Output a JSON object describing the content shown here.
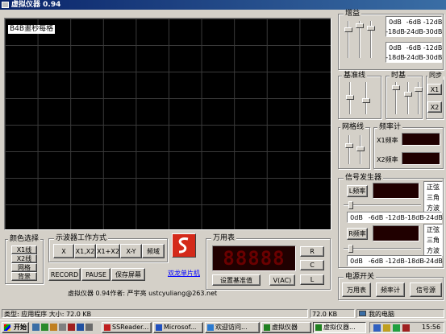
{
  "window": {
    "title": "虚拟仪器 0.94"
  },
  "scope": {
    "label": "B4B畫秒每格"
  },
  "gain": {
    "title": "增益",
    "row1": [
      "0dB",
      "-6dB",
      "-12dB",
      "-18dB",
      "-24dB",
      "-30dB"
    ],
    "row2": [
      "0dB",
      "-6dB",
      "-12dB",
      "-18dB",
      "-24dB",
      "-30dB"
    ]
  },
  "baseline": {
    "title": "基准线"
  },
  "timebase": {
    "title": "时基"
  },
  "sync": {
    "title": "同步",
    "x1": "X1",
    "x2": "X2"
  },
  "gridline": {
    "title": "网格线"
  },
  "freqmeter": {
    "title": "频率计",
    "x1_label": "X1频率",
    "x2_label": "X2频率"
  },
  "siggen": {
    "title": "信号发生器",
    "l_button": "L频率",
    "r_button": "R频率",
    "waves": [
      "正弦",
      "三角",
      "方波"
    ],
    "levels": [
      "0dB",
      "-6dB",
      "-12dB",
      "-18dB",
      "-24dB"
    ]
  },
  "color": {
    "title": "颜色选择",
    "items": [
      "X1线",
      "X2线",
      "网格",
      "背景"
    ]
  },
  "mode": {
    "title": "示波器工作方式",
    "items": [
      "X",
      "X1,X2",
      "X1+X2",
      "X-Y",
      "频域"
    ]
  },
  "record": {
    "record": "RECORD",
    "pause": "PAUSE",
    "save": "保存屏幕"
  },
  "logo": {
    "link": "双龙单片机"
  },
  "credit": {
    "text": "虚拟仪器 0.94作者: 严宇亮  ustcyuliang@263.net"
  },
  "meter": {
    "title": "万用表",
    "display": "88888",
    "r": "R",
    "c": "C",
    "l": "L",
    "set_baseline": "设置基准值",
    "vac": "V(AC)"
  },
  "power": {
    "title": "电源开关",
    "items": [
      "万用表",
      "频率计",
      "信号源"
    ]
  },
  "status": {
    "left": "类型: 应用程序 大小: 72.0 KB",
    "size": "72.0 KB",
    "computer": "我的电脑"
  },
  "taskbar": {
    "start": "开始",
    "tasks": [
      "SSReader...",
      "Microsof...",
      "欢迎访问...",
      "虚拟仪器",
      "虚拟仪器..."
    ],
    "clock": "15:56"
  },
  "colors": {
    "seg_bg": "#200000",
    "seg_fg": "#6a0000",
    "title_blue": "#0a246a",
    "logo_red": "#d42a1a"
  }
}
